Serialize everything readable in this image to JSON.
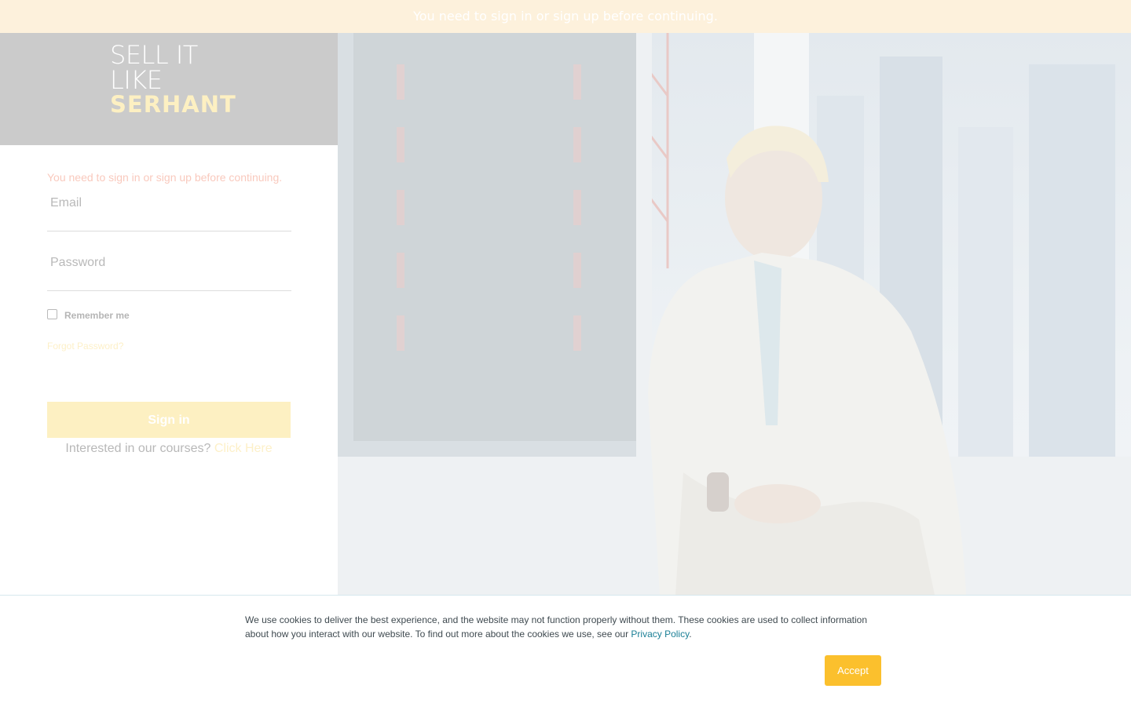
{
  "flash": {
    "message": "You need to sign in or sign up before continuing."
  },
  "logo": {
    "line1": "SELL IT LIKE",
    "line2": "SERHANT"
  },
  "form": {
    "alert": "You need to sign in or sign up before continuing.",
    "email_placeholder": "Email",
    "password_placeholder": "Password",
    "remember_label": "Remember me",
    "forgot_label": "Forgot Password?",
    "signin_label": "Sign in",
    "courses_text": "Interested in our courses?",
    "courses_link": "Click Here"
  },
  "cookie": {
    "text_before": "We use cookies to deliver the best experience, and the website may not function properly without them. These cookies are used to collect information about how you interact with our website. To find out more about the cookies we use, see our",
    "link": "Privacy Policy",
    "text_after": ".",
    "accept_label": "Accept"
  },
  "colors": {
    "accent": "#fbc02d",
    "link": "#1a7f96",
    "flash_bg": "#fdf1dc"
  }
}
